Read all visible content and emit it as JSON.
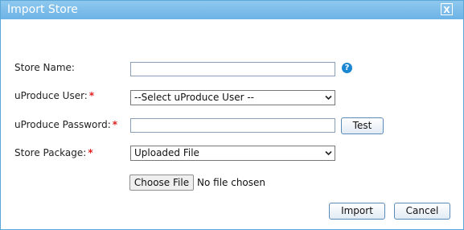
{
  "dialog": {
    "title": "Import Store",
    "close_label": "X"
  },
  "form": {
    "store_name_label": "Store Name:",
    "store_name_value": "",
    "user_label": "uProduce User:",
    "user_selected": "--Select uProduce User --",
    "password_label": "uProduce Password:",
    "password_value": "",
    "package_label": "Store Package:",
    "package_selected": "Uploaded File",
    "required_marker": "*",
    "help_icon_glyph": "?"
  },
  "buttons": {
    "test": "Test",
    "choose_file": "Choose File",
    "no_file_text": "No file chosen",
    "import": "Import",
    "cancel": "Cancel"
  },
  "colors": {
    "titlebar": "#6cb3e6",
    "required": "#e02020",
    "help_icon": "#1b86d1"
  }
}
